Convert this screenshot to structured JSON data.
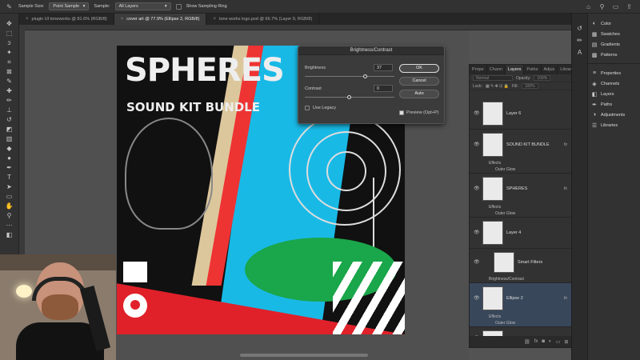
{
  "options_bar": {
    "sample_size_label": "Sample Size:",
    "sample_size_value": "Point Sample",
    "sample_label": "Sample:",
    "sample_value": "All Layers",
    "show_sampling_ring": "Show Sampling Ring"
  },
  "tabs": [
    {
      "label": "plugin UI toneworks @ 81.6% (RGB/8)"
    },
    {
      "label": "cover art @ 77.9% (Ellipse 2, RGB/8)"
    },
    {
      "label": "tone works logo.psd @ 66.7% (Layer 9, RGB/8)"
    }
  ],
  "artwork": {
    "title": "SPHERES",
    "subtitle": "SOUND KIT BUNDLE"
  },
  "dialog": {
    "title": "Brightness/Contrast",
    "brightness_label": "Brightness",
    "brightness_value": "37",
    "contrast_label": "Contrast",
    "contrast_value": "0",
    "ok_label": "OK",
    "cancel_label": "Cancel",
    "auto_label": "Auto",
    "use_legacy_label": "Use Legacy",
    "use_legacy_checked": false,
    "preview_label": "Preview (Opt+P)",
    "preview_checked": true,
    "brightness_slider_fraction": 0.68,
    "contrast_slider_fraction": 0.5
  },
  "layers_panel": {
    "tabs": [
      "Prope",
      "Chann",
      "Layers",
      "Paths",
      "Adjus",
      "Librar"
    ],
    "blend_mode": "Normal",
    "opacity_label": "Opacity:",
    "opacity_value": "100%",
    "lock_label": "Lock:",
    "fill_label": "Fill:",
    "fill_value": "100%",
    "layers": [
      {
        "name": "Layer 6",
        "fx": "",
        "subs": [],
        "selected": false
      },
      {
        "name": "SOUND KIT BUNDLE",
        "fx": "fx",
        "subs": [
          "Effects",
          "Outer Glow"
        ],
        "selected": false
      },
      {
        "name": "SPHERES",
        "fx": "fx",
        "subs": [
          "Effects",
          "Outer Glow"
        ],
        "selected": false
      },
      {
        "name": "Layer 4",
        "fx": "",
        "subs": [],
        "selected": false
      },
      {
        "name": "Smart Filters",
        "fx": "",
        "subs": [
          "Brightness/Contrast"
        ],
        "selected": false
      },
      {
        "name": "Ellipse 2",
        "fx": "fx",
        "subs": [
          "Effects",
          "Outer Glow"
        ],
        "selected": true
      },
      {
        "name": "Layer 5 copy 3",
        "fx": "",
        "subs": [],
        "selected": false
      }
    ]
  },
  "right_panel": {
    "items": [
      {
        "label": "Color",
        "icon": "color-icon"
      },
      {
        "label": "Swatches",
        "icon": "swatches-icon"
      },
      {
        "label": "Gradients",
        "icon": "gradients-icon"
      },
      {
        "label": "Patterns",
        "icon": "patterns-icon"
      },
      {
        "label": "Properties",
        "icon": "properties-icon"
      },
      {
        "label": "Channels",
        "icon": "channels-icon"
      },
      {
        "label": "Layers",
        "icon": "layers-icon"
      },
      {
        "label": "Paths",
        "icon": "paths-icon"
      },
      {
        "label": "Adjustments",
        "icon": "adjustments-icon"
      },
      {
        "label": "Libraries",
        "icon": "libraries-icon"
      }
    ]
  },
  "colors": {
    "accent_blue": "#19b9e6",
    "accent_red": "#e0212a",
    "accent_green": "#1aa64a",
    "selected_row": "#39475b"
  }
}
